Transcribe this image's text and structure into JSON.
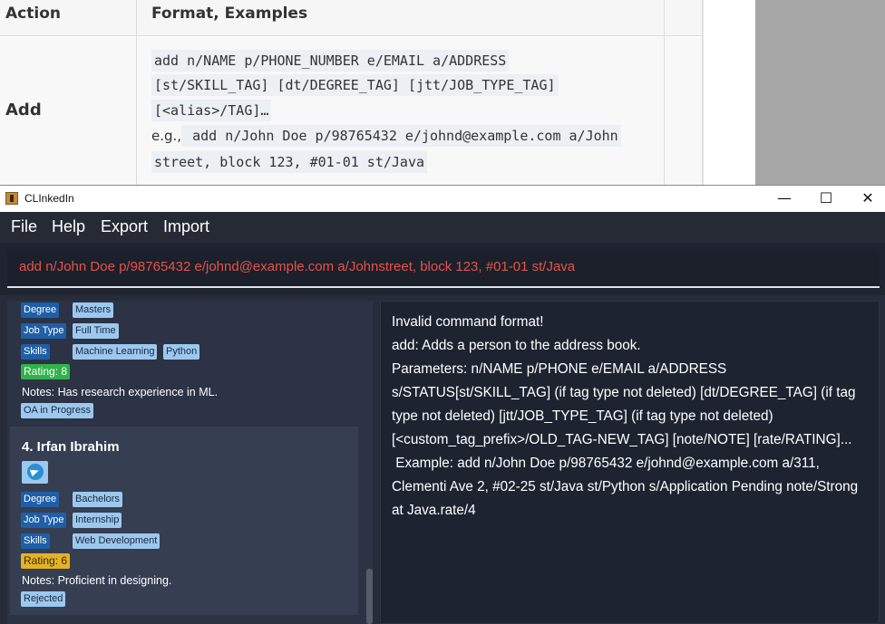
{
  "doc": {
    "col_action": "Action",
    "col_format": "Format, Examples",
    "row_label": "Add",
    "format_line1": " add n/NAME p/PHONE_NUMBER e/EMAIL a/ADDRESS",
    "format_line2": "[st/SKILL_TAG] [dt/DEGREE_TAG] [jtt/JOB_TYPE_TAG]",
    "format_line3": "[<alias>/TAG]…",
    "eg_label": "e.g.,",
    "example_line1": " add n/John Doe p/98765432 e/johnd@example.com a/John",
    "example_line2": "street, block 123, #01-01 st/Java "
  },
  "window": {
    "title": "CLInkedIn",
    "minimize": "—",
    "maximize": "☐",
    "close": "✕"
  },
  "menu": {
    "file": "File",
    "help": "Help",
    "export": "Export",
    "import": "Import"
  },
  "command": {
    "value": "add n/John Doe p/98765432 e/johnd@example.com a/Johnstreet, block 123, #01-01 st/Java"
  },
  "person3": {
    "degree_type": "Degree",
    "degree_value": "Masters",
    "job_type": "Job Type",
    "job_value": "Full Time",
    "skills_type": "Skills",
    "skill1": "Machine Learning",
    "skill2": "Python",
    "rating": "Rating: 8",
    "notes": "Notes: Has research experience in ML.",
    "status": "OA in Progress"
  },
  "person4": {
    "name": "4.  Irfan Ibrahim",
    "degree_type": "Degree",
    "degree_value": "Bachelors",
    "job_type": "Job Type",
    "job_value": "Internship",
    "skills_type": "Skills",
    "skill1": "Web Development",
    "rating": "Rating: 6",
    "notes": "Notes: Proficient in designing.",
    "status": "Rejected"
  },
  "result": {
    "text": "Invalid command format! \nadd: Adds a person to the address book. \nParameters: n/NAME p/PHONE e/EMAIL a/ADDRESS s/STATUS[st/SKILL_TAG] (if tag type not deleted) [dt/DEGREE_TAG] (if tag type not deleted) [jtt/JOB_TYPE_TAG] (if tag type not deleted) [<custom_tag_prefix>/OLD_TAG-NEW_TAG] [note/NOTE] [rate/RATING]...\n Example: add n/John Doe p/98765432 e/johnd@example.com a/311, Clementi Ave 2, #02-25 st/Java st/Python s/Application Pending note/Strong at Java.rate/4"
  },
  "icons": {
    "app": "app-icon",
    "telegram": "telegram-icon"
  },
  "colors": {
    "error_text": "#e5524b",
    "tag_type": "#1e5fa8",
    "tag_value": "#9cc8f0",
    "rating_high": "#2fb34a",
    "rating_mid": "#e4b226"
  }
}
